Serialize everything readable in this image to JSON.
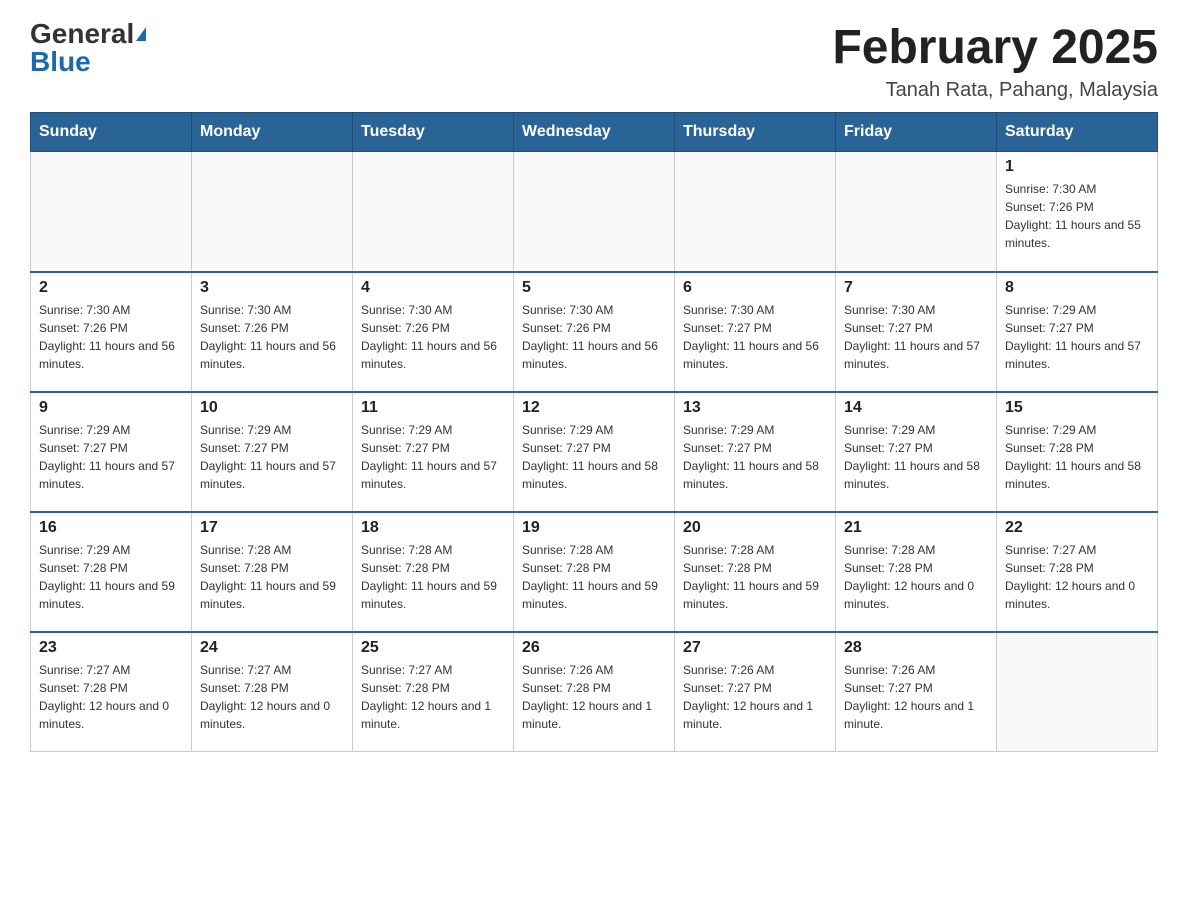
{
  "header": {
    "logo": {
      "general": "General",
      "blue": "Blue"
    },
    "title": "February 2025",
    "location": "Tanah Rata, Pahang, Malaysia"
  },
  "days_of_week": [
    "Sunday",
    "Monday",
    "Tuesday",
    "Wednesday",
    "Thursday",
    "Friday",
    "Saturday"
  ],
  "weeks": [
    [
      {
        "day": "",
        "info": ""
      },
      {
        "day": "",
        "info": ""
      },
      {
        "day": "",
        "info": ""
      },
      {
        "day": "",
        "info": ""
      },
      {
        "day": "",
        "info": ""
      },
      {
        "day": "",
        "info": ""
      },
      {
        "day": "1",
        "info": "Sunrise: 7:30 AM\nSunset: 7:26 PM\nDaylight: 11 hours and 55 minutes."
      }
    ],
    [
      {
        "day": "2",
        "info": "Sunrise: 7:30 AM\nSunset: 7:26 PM\nDaylight: 11 hours and 56 minutes."
      },
      {
        "day": "3",
        "info": "Sunrise: 7:30 AM\nSunset: 7:26 PM\nDaylight: 11 hours and 56 minutes."
      },
      {
        "day": "4",
        "info": "Sunrise: 7:30 AM\nSunset: 7:26 PM\nDaylight: 11 hours and 56 minutes."
      },
      {
        "day": "5",
        "info": "Sunrise: 7:30 AM\nSunset: 7:26 PM\nDaylight: 11 hours and 56 minutes."
      },
      {
        "day": "6",
        "info": "Sunrise: 7:30 AM\nSunset: 7:27 PM\nDaylight: 11 hours and 56 minutes."
      },
      {
        "day": "7",
        "info": "Sunrise: 7:30 AM\nSunset: 7:27 PM\nDaylight: 11 hours and 57 minutes."
      },
      {
        "day": "8",
        "info": "Sunrise: 7:29 AM\nSunset: 7:27 PM\nDaylight: 11 hours and 57 minutes."
      }
    ],
    [
      {
        "day": "9",
        "info": "Sunrise: 7:29 AM\nSunset: 7:27 PM\nDaylight: 11 hours and 57 minutes."
      },
      {
        "day": "10",
        "info": "Sunrise: 7:29 AM\nSunset: 7:27 PM\nDaylight: 11 hours and 57 minutes."
      },
      {
        "day": "11",
        "info": "Sunrise: 7:29 AM\nSunset: 7:27 PM\nDaylight: 11 hours and 57 minutes."
      },
      {
        "day": "12",
        "info": "Sunrise: 7:29 AM\nSunset: 7:27 PM\nDaylight: 11 hours and 58 minutes."
      },
      {
        "day": "13",
        "info": "Sunrise: 7:29 AM\nSunset: 7:27 PM\nDaylight: 11 hours and 58 minutes."
      },
      {
        "day": "14",
        "info": "Sunrise: 7:29 AM\nSunset: 7:27 PM\nDaylight: 11 hours and 58 minutes."
      },
      {
        "day": "15",
        "info": "Sunrise: 7:29 AM\nSunset: 7:28 PM\nDaylight: 11 hours and 58 minutes."
      }
    ],
    [
      {
        "day": "16",
        "info": "Sunrise: 7:29 AM\nSunset: 7:28 PM\nDaylight: 11 hours and 59 minutes."
      },
      {
        "day": "17",
        "info": "Sunrise: 7:28 AM\nSunset: 7:28 PM\nDaylight: 11 hours and 59 minutes."
      },
      {
        "day": "18",
        "info": "Sunrise: 7:28 AM\nSunset: 7:28 PM\nDaylight: 11 hours and 59 minutes."
      },
      {
        "day": "19",
        "info": "Sunrise: 7:28 AM\nSunset: 7:28 PM\nDaylight: 11 hours and 59 minutes."
      },
      {
        "day": "20",
        "info": "Sunrise: 7:28 AM\nSunset: 7:28 PM\nDaylight: 11 hours and 59 minutes."
      },
      {
        "day": "21",
        "info": "Sunrise: 7:28 AM\nSunset: 7:28 PM\nDaylight: 12 hours and 0 minutes."
      },
      {
        "day": "22",
        "info": "Sunrise: 7:27 AM\nSunset: 7:28 PM\nDaylight: 12 hours and 0 minutes."
      }
    ],
    [
      {
        "day": "23",
        "info": "Sunrise: 7:27 AM\nSunset: 7:28 PM\nDaylight: 12 hours and 0 minutes."
      },
      {
        "day": "24",
        "info": "Sunrise: 7:27 AM\nSunset: 7:28 PM\nDaylight: 12 hours and 0 minutes."
      },
      {
        "day": "25",
        "info": "Sunrise: 7:27 AM\nSunset: 7:28 PM\nDaylight: 12 hours and 1 minute."
      },
      {
        "day": "26",
        "info": "Sunrise: 7:26 AM\nSunset: 7:28 PM\nDaylight: 12 hours and 1 minute."
      },
      {
        "day": "27",
        "info": "Sunrise: 7:26 AM\nSunset: 7:27 PM\nDaylight: 12 hours and 1 minute."
      },
      {
        "day": "28",
        "info": "Sunrise: 7:26 AM\nSunset: 7:27 PM\nDaylight: 12 hours and 1 minute."
      },
      {
        "day": "",
        "info": ""
      }
    ]
  ]
}
